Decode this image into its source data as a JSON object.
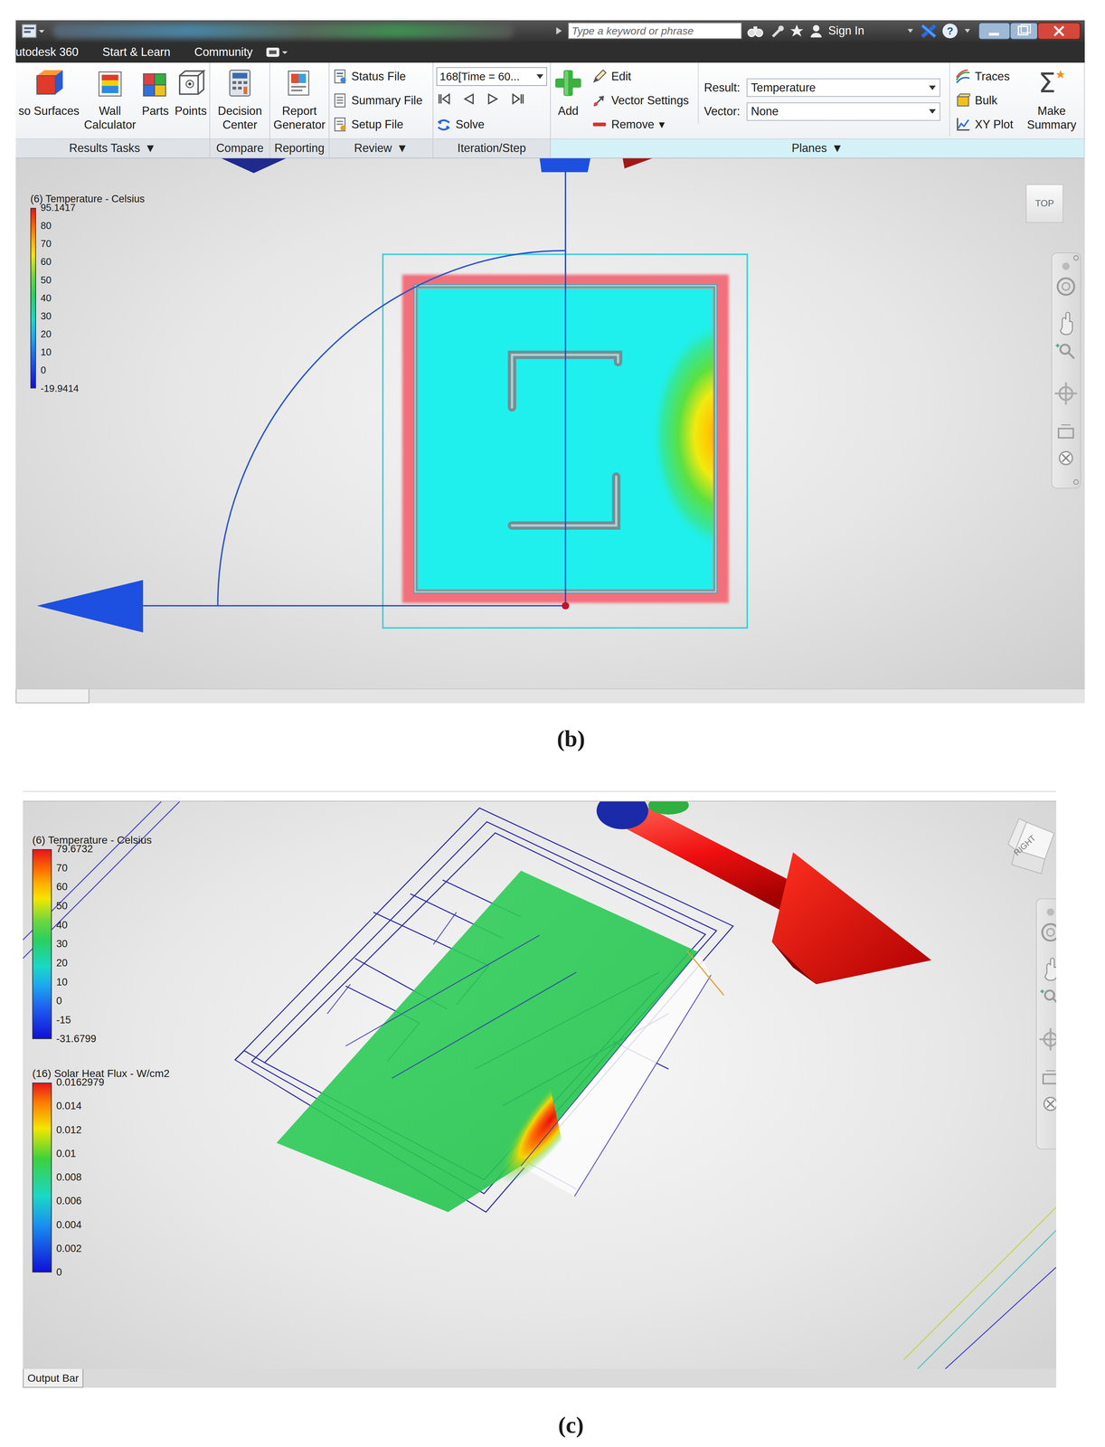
{
  "figure_b": {
    "caption": "(b)",
    "title_bar": {
      "search_placeholder": "Type a keyword or phrase",
      "sign_in": "Sign In",
      "help": "?"
    },
    "menu_tabs": [
      "utodesk 360",
      "Start & Learn",
      "Community"
    ],
    "ribbon_groups": [
      {
        "label": "Results Tasks",
        "arrow": "▼",
        "context": false,
        "columns": [
          {
            "kind": "large",
            "label": "so Surfaces"
          },
          {
            "kind": "large",
            "label": "Wall Calculator"
          },
          {
            "kind": "large",
            "label": "Parts"
          },
          {
            "kind": "large",
            "label": "Points"
          }
        ]
      },
      {
        "label": "Compare",
        "context": false,
        "columns": [
          {
            "kind": "large",
            "label": "Decision Center"
          }
        ]
      },
      {
        "label": "Reporting",
        "context": false,
        "columns": [
          {
            "kind": "large",
            "label": "Report Generator"
          }
        ]
      },
      {
        "label": "Review",
        "arrow": "▼",
        "context": false,
        "columns": [
          {
            "kind": "stack",
            "rows": [
              {
                "kind": "small",
                "label": "Status File"
              },
              {
                "kind": "small",
                "label": "Summary File"
              },
              {
                "kind": "small",
                "label": "Setup File"
              }
            ]
          }
        ]
      },
      {
        "label": "Iteration/Step",
        "context": false,
        "columns": [
          {
            "kind": "stack",
            "rows": [
              {
                "kind": "dropdown",
                "label": "168[Time = 60..."
              },
              {
                "kind": "steps"
              },
              {
                "kind": "small",
                "label": "Solve"
              }
            ]
          }
        ]
      },
      {
        "label": "Planes",
        "arrow": "▼",
        "context": true,
        "columns": [
          {
            "kind": "large",
            "label": "Add"
          },
          {
            "kind": "stack",
            "rows": [
              {
                "kind": "small",
                "label": "Edit"
              },
              {
                "kind": "small",
                "label": "Vector Settings"
              },
              {
                "kind": "small",
                "label": "Remove",
                "arrow": "▾"
              }
            ]
          },
          {
            "kind": "stack",
            "rows": [
              {
                "kind": "field",
                "label": "Result:",
                "value": "Temperature"
              },
              {
                "kind": "field",
                "label": "Vector:",
                "value": "None"
              }
            ]
          },
          {
            "kind": "stack",
            "rows": [
              {
                "kind": "small",
                "label": "Traces"
              },
              {
                "kind": "small",
                "label": "Bulk"
              },
              {
                "kind": "small",
                "label": "XY Plot"
              }
            ]
          },
          {
            "kind": "large",
            "label": "Make Summary",
            "icon_text": "Σ"
          }
        ]
      }
    ],
    "legend": {
      "kind": "temperature",
      "title": "(6) Temperature - Celsius",
      "max": "95.1417",
      "ticks": [
        "80",
        "70",
        "60",
        "50",
        "40",
        "30",
        "20",
        "10",
        "0"
      ],
      "min": "-19.9414"
    },
    "view_cube": "TOP"
  },
  "figure_c": {
    "caption": "(c)",
    "legends": [
      {
        "kind": "temperature",
        "title": "(6) Temperature - Celsius",
        "max": "79.6732",
        "ticks": [
          "70",
          "60",
          "50",
          "40",
          "30",
          "20",
          "10",
          "0",
          "-15"
        ],
        "min": "-31.6799"
      },
      {
        "kind": "flux",
        "title": "(16) Solar Heat Flux - W/cm2",
        "max": "0.0162979",
        "ticks": [
          "0.014",
          "0.012",
          "0.01",
          "0.008",
          "0.006",
          "0.004",
          "0.002"
        ],
        "min": "0"
      }
    ],
    "view_cube": "RIGHT",
    "output_bar": "Output Bar"
  }
}
